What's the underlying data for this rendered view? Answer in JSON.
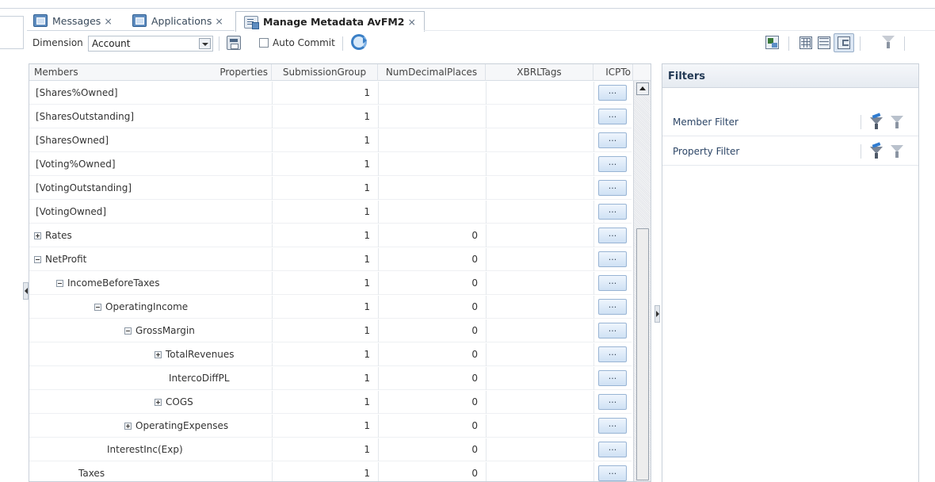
{
  "tabs": [
    {
      "label": "Messages",
      "close": "×",
      "icon": "messages-tile-icon"
    },
    {
      "label": "Applications",
      "close": "×",
      "icon": "applications-tile-icon"
    },
    {
      "label": "Manage Metadata AvFM2",
      "close": "×",
      "icon": "metadata-icon",
      "active": true
    }
  ],
  "toolbar": {
    "dimension_label": "Dimension",
    "dimension_value": "Account",
    "auto_commit_label": "Auto Commit",
    "auto_commit_checked": false
  },
  "grid": {
    "headers": {
      "members": "Members",
      "properties": "Properties",
      "submission_group": "SubmissionGroup",
      "num_decimal_places": "NumDecimalPlaces",
      "xbrl_tags": "XBRLTags",
      "icp": "ICPTo"
    },
    "ellipsis": "...",
    "rows": [
      {
        "member": "[Shares%Owned]",
        "expander": "none",
        "submission_group": "1",
        "num_decimal_places": "",
        "xbrl_tags": ""
      },
      {
        "member": "[SharesOutstanding]",
        "expander": "none",
        "submission_group": "1",
        "num_decimal_places": "",
        "xbrl_tags": ""
      },
      {
        "member": "[SharesOwned]",
        "expander": "none",
        "submission_group": "1",
        "num_decimal_places": "",
        "xbrl_tags": ""
      },
      {
        "member": "[Voting%Owned]",
        "expander": "none",
        "submission_group": "1",
        "num_decimal_places": "",
        "xbrl_tags": ""
      },
      {
        "member": "[VotingOutstanding]",
        "expander": "none",
        "submission_group": "1",
        "num_decimal_places": "",
        "xbrl_tags": ""
      },
      {
        "member": "[VotingOwned]",
        "expander": "none",
        "submission_group": "1",
        "num_decimal_places": "",
        "xbrl_tags": ""
      },
      {
        "member": "Rates",
        "expander": "plus",
        "submission_group": "1",
        "num_decimal_places": "0",
        "xbrl_tags": ""
      },
      {
        "member": "NetProfit",
        "expander": "minus",
        "submission_group": "1",
        "num_decimal_places": "0",
        "xbrl_tags": ""
      },
      {
        "member": "IncomeBeforeTaxes",
        "expander": "minus",
        "submission_group": "1",
        "num_decimal_places": "0",
        "xbrl_tags": ""
      },
      {
        "member": "OperatingIncome",
        "expander": "minus",
        "submission_group": "1",
        "num_decimal_places": "0",
        "xbrl_tags": ""
      },
      {
        "member": "GrossMargin",
        "expander": "minus",
        "submission_group": "1",
        "num_decimal_places": "0",
        "xbrl_tags": ""
      },
      {
        "member": "TotalRevenues",
        "expander": "plus",
        "submission_group": "1",
        "num_decimal_places": "0",
        "xbrl_tags": ""
      },
      {
        "member": "IntercoDiffPL",
        "expander": "none",
        "submission_group": "1",
        "num_decimal_places": "0",
        "xbrl_tags": ""
      },
      {
        "member": "COGS",
        "expander": "plus",
        "submission_group": "1",
        "num_decimal_places": "0",
        "xbrl_tags": ""
      },
      {
        "member": "OperatingExpenses",
        "expander": "plus",
        "submission_group": "1",
        "num_decimal_places": "0",
        "xbrl_tags": ""
      },
      {
        "member": "InterestInc(Exp)",
        "expander": "none",
        "submission_group": "1",
        "num_decimal_places": "0",
        "xbrl_tags": ""
      },
      {
        "member": "Taxes",
        "expander": "none",
        "submission_group": "1",
        "num_decimal_places": "0",
        "xbrl_tags": ""
      }
    ]
  },
  "filters": {
    "title": "Filters",
    "items": [
      {
        "label": "Member Filter"
      },
      {
        "label": "Property Filter"
      }
    ]
  }
}
